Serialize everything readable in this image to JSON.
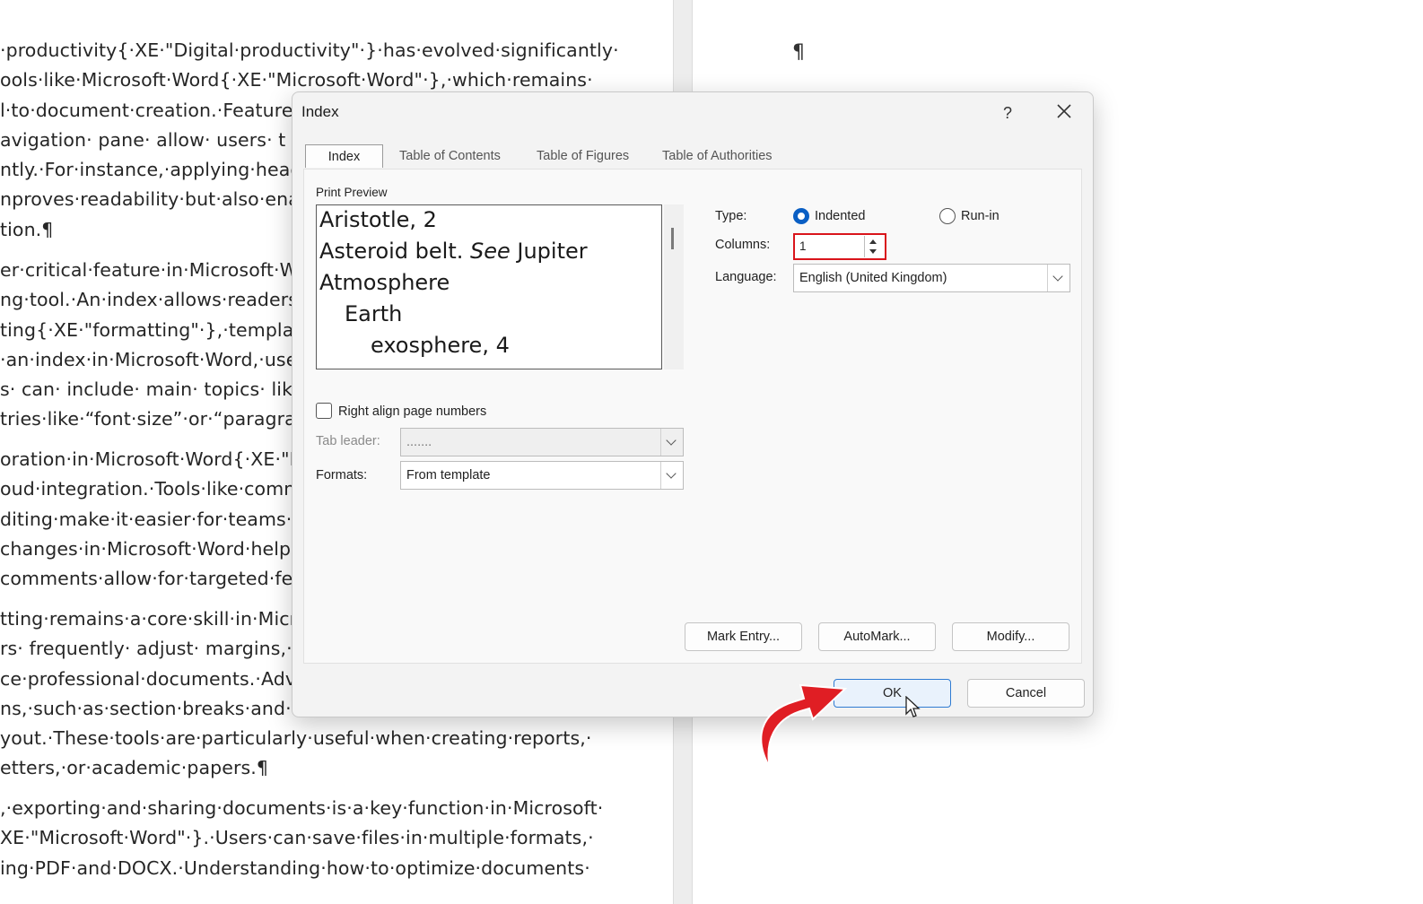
{
  "document": {
    "lines": [
      "·productivity{·XE·\"Digital·productivity\"·}·has·evolved·significantly·",
      "ools·like·Microsoft·Word{·XE·\"Microsoft·Word\"·},·which·remains·",
      "l·to·document·creation.·Features",
      "avigation· pane· allow· users· t",
      "ntly.·For·instance,·applying·headi",
      "nproves·readability·but·also·enab",
      "tion.¶",
      "er·critical·feature·in·Microsoft·W",
      "ng·tool.·An·index·allows·readers",
      "ting{·XE·\"formatting\"·},·templates",
      "·an·index·in·Microsoft·Word,·user",
      "s· can· include· main· topics· like",
      "tries·like·“font·size”·or·“paragraph",
      "oration·in·Microsoft·Word{·XE·\"M",
      "oud·integration.·Tools·like·comm",
      "diting·make·it·easier·for·teams·",
      "changes·in·Microsoft·Word·helps",
      "comments·allow·for·targeted·feed",
      "tting·remains·a·core·skill·in·Micro",
      "rs· frequently· adjust· margins,· li",
      "ce·professional·documents.·Adva",
      "ns,·such·as·section·breaks·and·c",
      "yout.·These·tools·are·particularly·useful·when·creating·reports,·",
      "etters,·or·academic·papers.¶",
      ",·exporting·and·sharing·documents·is·a·key·function·in·Microsoft·",
      "XE·\"Microsoft·Word\"·}.·Users·can·save·files·in·multiple·formats,·",
      "ing·PDF·and·DOCX.·Understanding·how·to·optimize·documents·"
    ],
    "right_page_mark": "¶"
  },
  "dialog": {
    "title": "Index",
    "help": "?",
    "close": "✕",
    "tabs": [
      "Index",
      "Table of Contents",
      "Table of Figures",
      "Table of Authorities"
    ],
    "print_preview_label": "Print Preview",
    "preview_lines": [
      "Aristotle, 2",
      "Asteroid belt. ",
      "See",
      " Jupiter",
      "Atmosphere",
      "Earth",
      "exosphere, 4"
    ],
    "type_label": "Type:",
    "type_options": [
      "Indented",
      "Run-in"
    ],
    "type_selected": "Indented",
    "columns_label": "Columns:",
    "columns_value": "1",
    "language_label": "Language:",
    "language_value": "English (United Kingdom)",
    "right_align_label": "Right align page numbers",
    "right_align_checked": false,
    "tab_leader_label": "Tab leader:",
    "tab_leader_value": ".......",
    "formats_label": "Formats:",
    "formats_value": "From template",
    "buttons": {
      "mark_entry": "Mark Entry...",
      "automark": "AutoMark...",
      "modify": "Modify...",
      "ok": "OK",
      "cancel": "Cancel"
    },
    "highlight_color": "#d9141b",
    "annotation_arrow_color": "#e01e24"
  }
}
